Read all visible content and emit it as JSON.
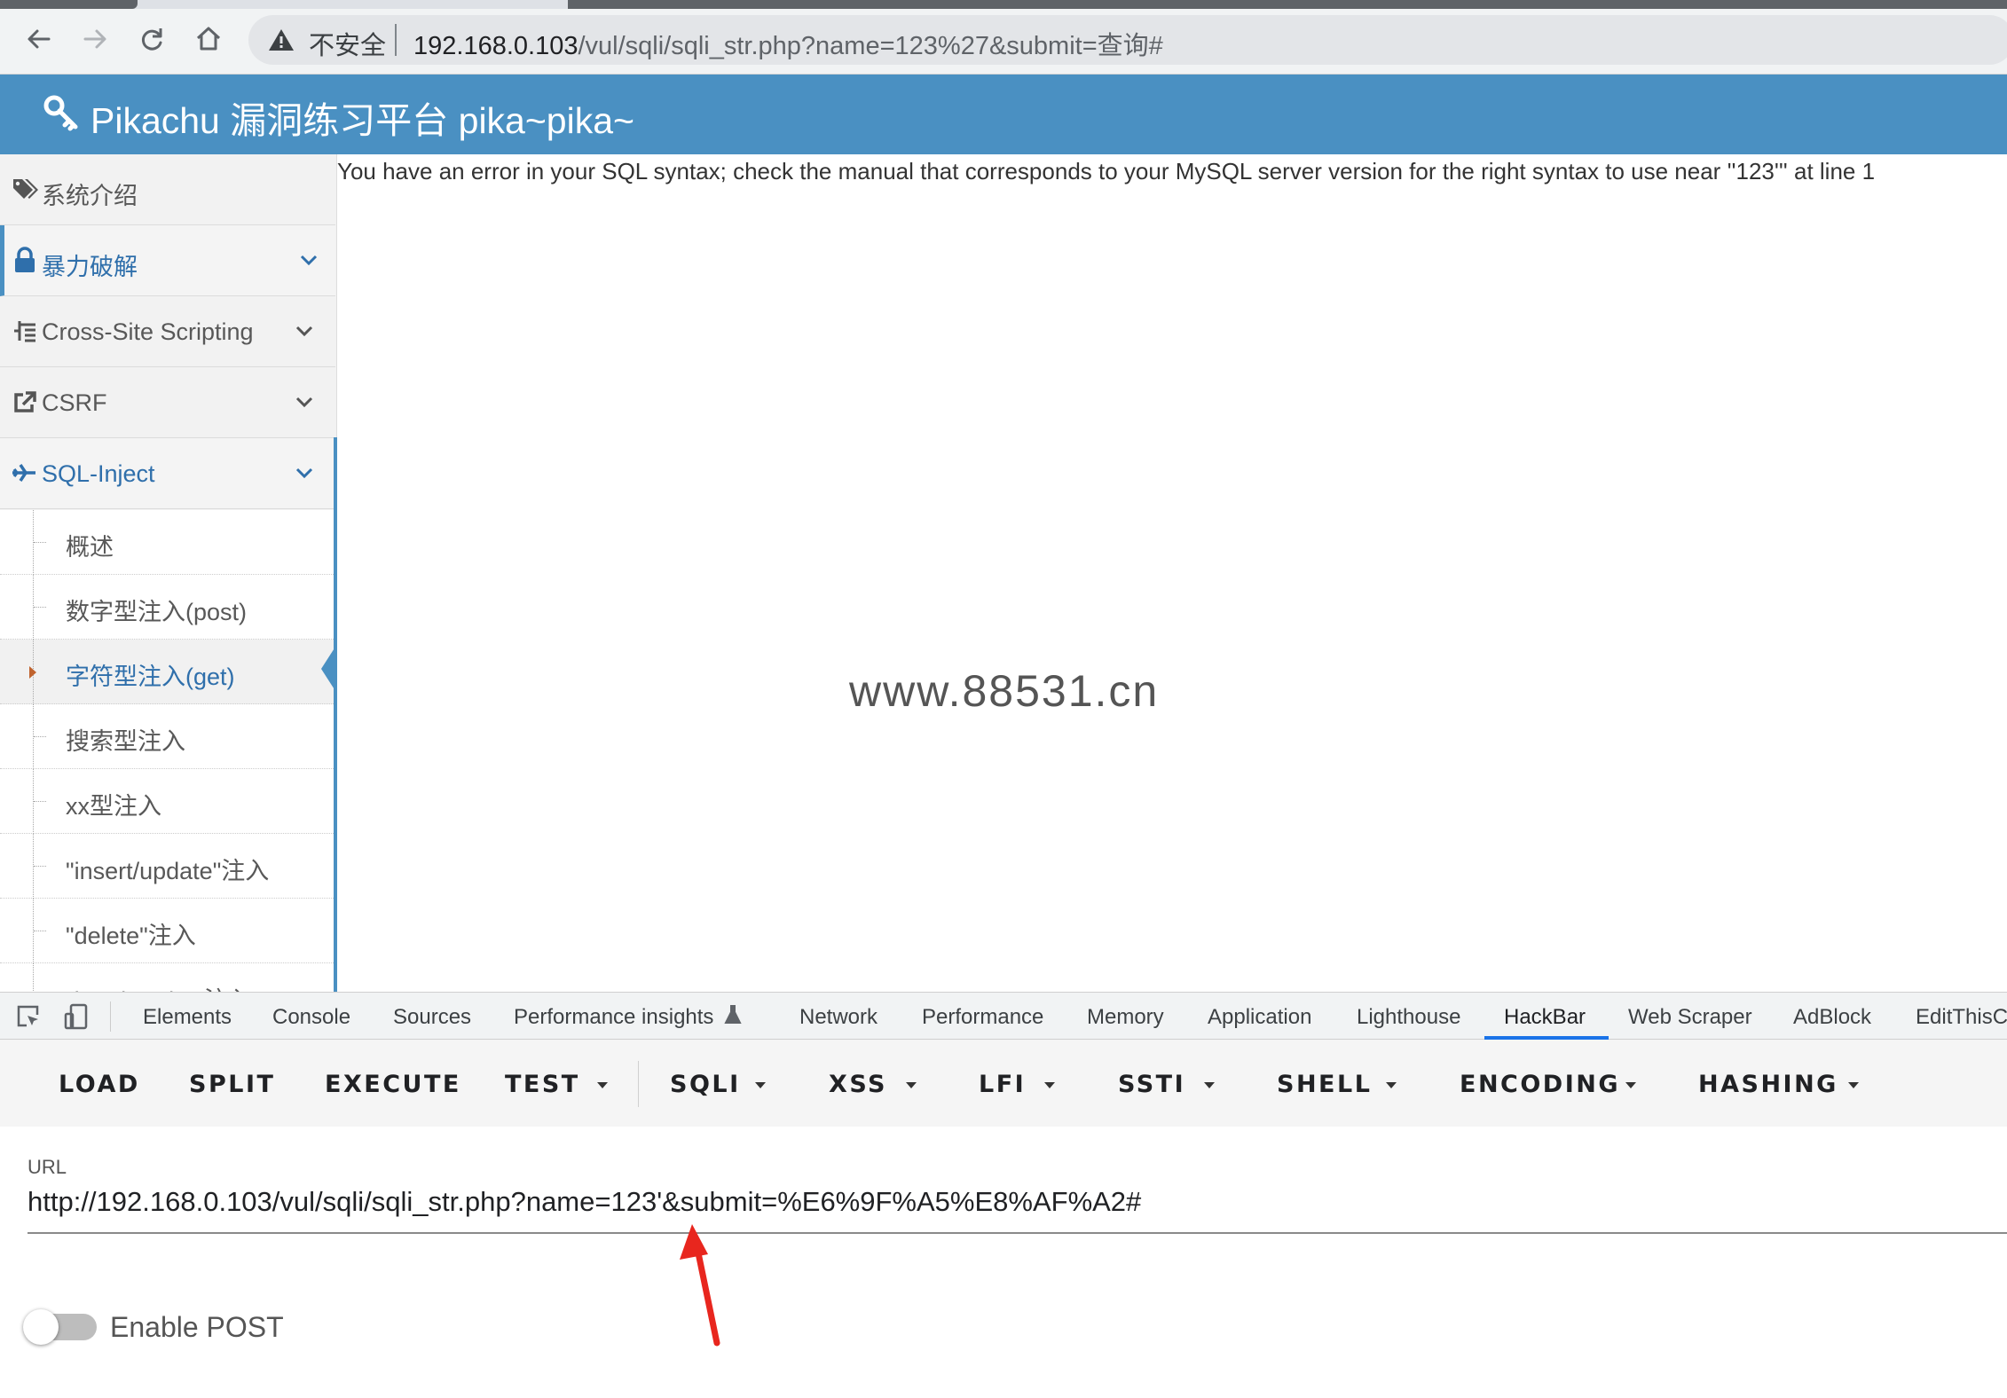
{
  "browser": {
    "security_label": "不安全",
    "address_host": "192.168.0.103",
    "address_path": "/vul/sqli/sqli_str.php?name=123%27&submit=查询#"
  },
  "site": {
    "title": "Pikachu 漏洞练习平台 pika~pika~"
  },
  "sidebar": {
    "items": [
      {
        "label": "系统介绍",
        "icon": "tags-icon"
      },
      {
        "label": "暴力破解",
        "icon": "lock-icon"
      },
      {
        "label": "Cross-Site Scripting",
        "icon": "list-tree-icon"
      },
      {
        "label": "CSRF",
        "icon": "share-square-icon"
      },
      {
        "label": "SQL-Inject",
        "icon": "plane-icon"
      }
    ],
    "sub_items": [
      {
        "label": "概述"
      },
      {
        "label": "数字型注入(post)"
      },
      {
        "label": "字符型注入(get)"
      },
      {
        "label": "搜索型注入"
      },
      {
        "label": "xx型注入"
      },
      {
        "label": "\"insert/update\"注入"
      },
      {
        "label": "\"delete\"注入"
      },
      {
        "label": "\"http header\"注入"
      }
    ]
  },
  "main": {
    "error_message": "You have an error in your SQL syntax; check the manual that corresponds to your MySQL server version for the right syntax to use near ''123''' at line 1",
    "watermark": "www.88531.cn"
  },
  "devtools": {
    "tabs": [
      "Elements",
      "Console",
      "Sources",
      "Performance insights",
      "Network",
      "Performance",
      "Memory",
      "Application",
      "Lighthouse",
      "HackBar",
      "Web Scraper",
      "AdBlock",
      "EditThisC"
    ],
    "active_tab": "HackBar"
  },
  "hackbar": {
    "buttons": [
      "LOAD",
      "SPLIT",
      "EXECUTE",
      "TEST",
      "SQLI",
      "XSS",
      "LFI",
      "SSTI",
      "SHELL",
      "ENCODING",
      "HASHING"
    ],
    "url_label": "URL",
    "url_value": "http://192.168.0.103/vul/sqli/sqli_str.php?name=123'&submit=%E6%9F%A5%E8%AF%A2#",
    "enable_post_label": "Enable POST",
    "enable_post": false
  },
  "colors": {
    "header_blue": "#4a90c2",
    "link_blue": "#2f6fab",
    "annotation_red": "#e8261e",
    "devtools_accent": "#1a73e8"
  }
}
